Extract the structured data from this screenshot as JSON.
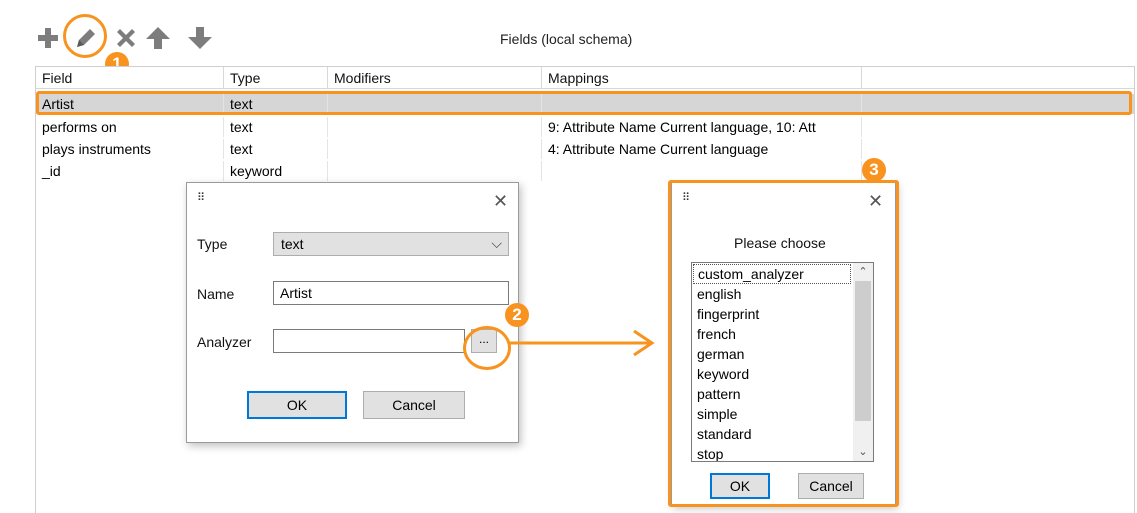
{
  "panel": {
    "title": "Fields (local schema)"
  },
  "toolbar": {
    "add_icon": "plus-icon",
    "edit_icon": "pencil-icon",
    "delete_icon": "x-icon",
    "up_icon": "arrow-up-icon",
    "down_icon": "arrow-down-icon"
  },
  "table": {
    "columns": [
      "Field",
      "Type",
      "Modifiers",
      "Mappings",
      ""
    ],
    "rows": [
      {
        "field": "Artist",
        "type": "text",
        "modifiers": "",
        "mappings": "",
        "selected": true
      },
      {
        "field": "performs on",
        "type": "text",
        "modifiers": "",
        "mappings": "9: Attribute Name Current language, 10: Att"
      },
      {
        "field": "plays instruments",
        "type": "text",
        "modifiers": "",
        "mappings": "4: Attribute Name Current language"
      },
      {
        "field": "_id",
        "type": "keyword",
        "modifiers": "",
        "mappings": ""
      }
    ]
  },
  "field_dialog": {
    "close": "✕",
    "type_label": "Type",
    "type_value": "text",
    "name_label": "Name",
    "name_value": "Artist",
    "analyzer_label": "Analyzer",
    "analyzer_value": "",
    "browse_label": "...",
    "ok_label": "OK",
    "cancel_label": "Cancel"
  },
  "choose_dialog": {
    "close": "✕",
    "prompt": "Please choose",
    "options": [
      "custom_analyzer",
      "english",
      "fingerprint",
      "french",
      "german",
      "keyword",
      "pattern",
      "simple",
      "standard",
      "stop"
    ],
    "ok_label": "OK",
    "cancel_label": "Cancel"
  },
  "annotations": {
    "step1": "1",
    "step2": "2",
    "step3": "3",
    "accent_color": "#f7931e"
  }
}
